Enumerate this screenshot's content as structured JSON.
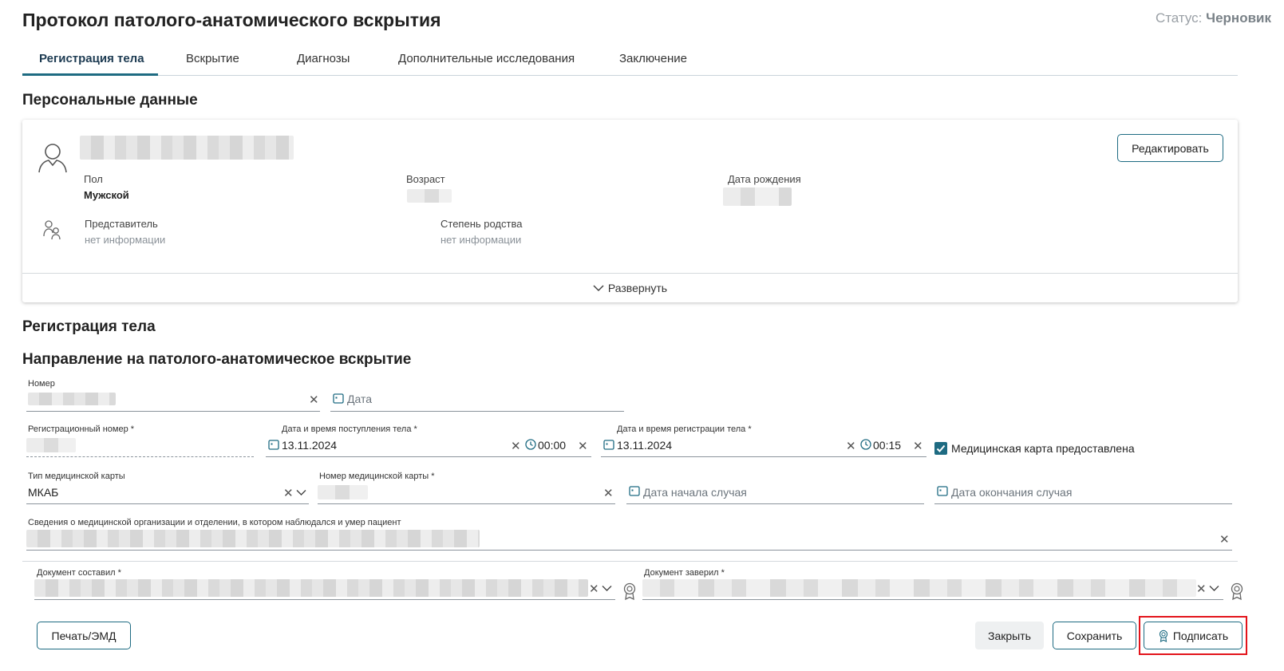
{
  "page": {
    "title": "Протокол патолого-анатомического вскрытия",
    "status_label": "Статус:",
    "status_value": "Черновик"
  },
  "tabs": [
    {
      "label": "Регистрация тела",
      "active": true
    },
    {
      "label": "Вскрытие",
      "active": false
    },
    {
      "label": "Диагнозы",
      "active": false
    },
    {
      "label": "Дополнительные исследования",
      "active": false
    },
    {
      "label": "Заключение",
      "active": false
    }
  ],
  "personal": {
    "section_title": "Персональные данные",
    "edit_label": "Редактировать",
    "sex_label": "Пол",
    "sex_value": "Мужской",
    "age_label": "Возраст",
    "dob_label": "Дата рождения",
    "rep_label": "Представитель",
    "rep_value": "нет информации",
    "kin_label": "Степень родства",
    "kin_value": "нет информации",
    "expand_label": "Развернуть"
  },
  "registration": {
    "section_title": "Регистрация тела",
    "subsection_title": "Направление на патолого-анатомическое вскрытие",
    "number_label": "Номер",
    "date_placeholder": "Дата",
    "reg_number_label": "Регистрационный номер *",
    "arrival_label": "Дата и время поступления тела *",
    "arrival_date": "13.11.2024",
    "arrival_time": "00:00",
    "reg_dt_label": "Дата и время регистрации тела *",
    "reg_date": "13.11.2024",
    "reg_time": "00:15",
    "card_provided_label": "Медицинская карта предоставлена",
    "card_provided": true,
    "card_type_label": "Тип медицинской карты",
    "card_type_value": "МКАБ",
    "card_number_label": "Номер медицинской карты *",
    "case_start_placeholder": "Дата начала случая",
    "case_end_placeholder": "Дата окончания случая",
    "org_label": "Сведения о медицинской организации и отделении, в котором наблюдался и умер пациент",
    "composed_label": "Документ составил *",
    "certified_label": "Документ заверил *"
  },
  "footer": {
    "print_label": "Печать/ЭМД",
    "close_label": "Закрыть",
    "save_label": "Сохранить",
    "sign_label": "Подписать"
  },
  "colors": {
    "accent": "#1e6b82",
    "highlight": "#e3141b"
  }
}
